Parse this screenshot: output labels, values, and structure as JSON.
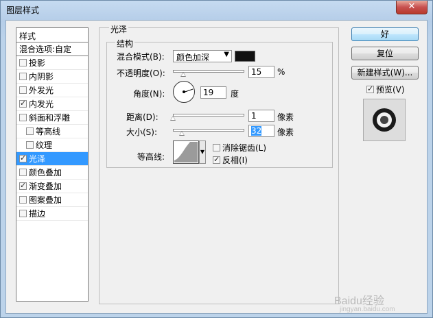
{
  "window": {
    "title": "图层样式",
    "close_label": "✕"
  },
  "style_list": {
    "header": "样式",
    "items": [
      {
        "label": "混合选项:自定",
        "checkbox": false,
        "checked": false,
        "selected": false,
        "indent": false
      },
      {
        "label": "投影",
        "checkbox": true,
        "checked": false,
        "selected": false,
        "indent": false
      },
      {
        "label": "内阴影",
        "checkbox": true,
        "checked": false,
        "selected": false,
        "indent": false
      },
      {
        "label": "外发光",
        "checkbox": true,
        "checked": false,
        "selected": false,
        "indent": false
      },
      {
        "label": "内发光",
        "checkbox": true,
        "checked": true,
        "selected": false,
        "indent": false
      },
      {
        "label": "斜面和浮雕",
        "checkbox": true,
        "checked": false,
        "selected": false,
        "indent": false
      },
      {
        "label": "等高线",
        "checkbox": true,
        "checked": false,
        "selected": false,
        "indent": true
      },
      {
        "label": "纹理",
        "checkbox": true,
        "checked": false,
        "selected": false,
        "indent": true
      },
      {
        "label": "光泽",
        "checkbox": true,
        "checked": true,
        "selected": true,
        "indent": false
      },
      {
        "label": "颜色叠加",
        "checkbox": true,
        "checked": false,
        "selected": false,
        "indent": false
      },
      {
        "label": "渐变叠加",
        "checkbox": true,
        "checked": true,
        "selected": false,
        "indent": false
      },
      {
        "label": "图案叠加",
        "checkbox": true,
        "checked": false,
        "selected": false,
        "indent": false
      },
      {
        "label": "描边",
        "checkbox": true,
        "checked": false,
        "selected": false,
        "indent": false
      }
    ]
  },
  "satin": {
    "group_title": "光泽",
    "structure_title": "结构",
    "blend_mode_label": "混合模式(B):",
    "blend_mode_value": "颜色加深",
    "blend_color": "#111111",
    "opacity_label": "不透明度(O):",
    "opacity_value": "15",
    "opacity_unit": "%",
    "opacity_fraction": 0.15,
    "angle_label": "角度(N):",
    "angle_value": "19",
    "angle_unit": "度",
    "distance_label": "距离(D):",
    "distance_value": "1",
    "distance_unit": "像素",
    "distance_fraction": 0.0,
    "size_label": "大小(S):",
    "size_value": "32",
    "size_unit": "像素",
    "size_fraction": 0.13,
    "contour_label": "等高线:",
    "anti_alias_label": "消除锯齿(L)",
    "anti_alias_checked": false,
    "invert_label": "反相(I)",
    "invert_checked": true
  },
  "buttons": {
    "ok": "好",
    "reset": "复位",
    "new_style": "新建样式(W)...",
    "preview_label": "预览(V)",
    "preview_checked": true
  },
  "watermark": {
    "text": "Baidu经验",
    "sub": "jingyan.baidu.com"
  }
}
